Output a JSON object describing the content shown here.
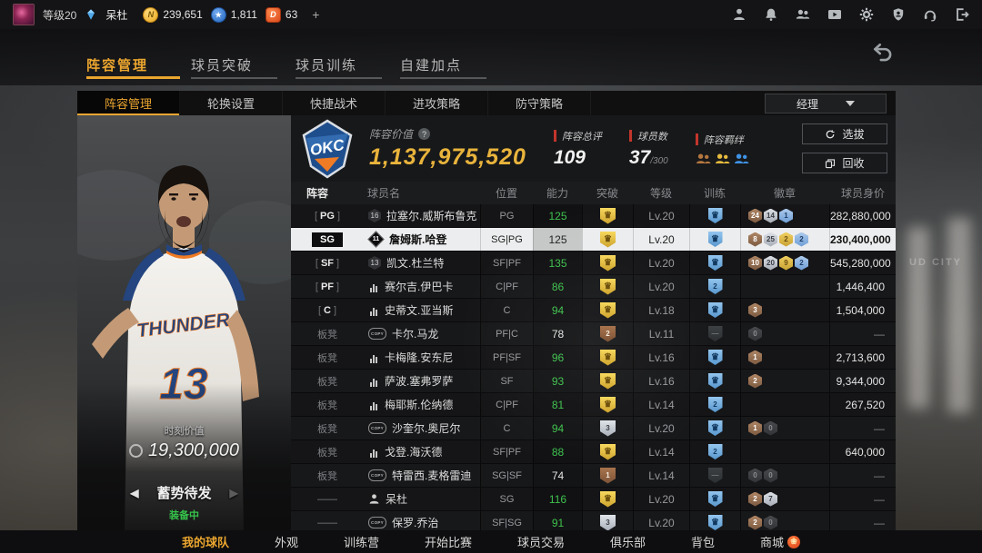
{
  "top_bar": {
    "level": "等级20",
    "username": "呆杜",
    "add_button": "+",
    "currencies": [
      {
        "name": "gold-coin",
        "glyph": "N",
        "label": "239,651"
      },
      {
        "name": "star-points",
        "glyph": "★",
        "label": "1,811"
      },
      {
        "name": "diamond-d",
        "glyph": "D",
        "label": "63"
      }
    ],
    "action_icons": [
      "profile-icon",
      "bell-icon",
      "friends-icon",
      "video-icon",
      "gear-icon",
      "security-icon",
      "headset-icon",
      "exit-icon"
    ]
  },
  "main_tabs": [
    {
      "label": "阵容管理",
      "active": true
    },
    {
      "label": "球员突破",
      "active": false
    },
    {
      "label": "球员训练",
      "active": false
    },
    {
      "label": "自建加点",
      "active": false
    }
  ],
  "sub_tabs": [
    {
      "label": "阵容管理",
      "active": true
    },
    {
      "label": "轮换设置",
      "active": false
    },
    {
      "label": "快捷战术",
      "active": false
    },
    {
      "label": "进攻策略",
      "active": false
    },
    {
      "label": "防守策略",
      "active": false
    }
  ],
  "manager_dropdown": "经理",
  "team": {
    "logo_text": "OKC",
    "value_label": "阵容价值",
    "value_help": "?",
    "value": "1,137,975,520",
    "stats": [
      {
        "label": "阵容总评",
        "value": "109",
        "suffix": ""
      },
      {
        "label": "球员数",
        "value": "37",
        "suffix": "/300"
      }
    ],
    "synergy_label": "阵容羁绊",
    "synergy_tiers": [
      "bronze",
      "gold",
      "blue"
    ],
    "select_button": "选拔",
    "recycle_button": "回收"
  },
  "player_panel": {
    "value_label": "时刻价值",
    "value": "19,300,000",
    "moment": "蓄势待发",
    "status": "装备中",
    "prev_glyph": "◀",
    "next_glyph": "▶",
    "jersey_text": "THUNDER",
    "jersey_number": "13"
  },
  "table": {
    "headers": [
      "阵容",
      "球员名",
      "位置",
      "能力",
      "突破",
      "等级",
      "训练",
      "徽章",
      "球员身价"
    ],
    "rows": [
      {
        "slot": "PG",
        "slot_type": "starter",
        "icon": "num",
        "icon_text": "16",
        "name": "拉塞尔.威斯布鲁克",
        "pos": "PG",
        "ability": "125",
        "ability_state": "green",
        "break_tier": "gold",
        "break_glyph": "crown",
        "level": "Lv.20",
        "train_tier": "blue",
        "train_glyph": "crown",
        "badges": [
          [
            "bronze",
            "24"
          ],
          [
            "silver",
            "14"
          ],
          [
            "blue",
            "1"
          ]
        ],
        "price": "282,880,000",
        "selected": false
      },
      {
        "slot": "SG",
        "slot_type": "starter",
        "icon": "diamond",
        "icon_text": "11",
        "name": "詹姆斯.哈登",
        "pos": "SG|PG",
        "ability": "125",
        "ability_state": "plain",
        "break_tier": "gold",
        "break_glyph": "crown",
        "level": "Lv.20",
        "train_tier": "blue",
        "train_glyph": "crown",
        "badges": [
          [
            "bronze",
            "8"
          ],
          [
            "silver",
            "25"
          ],
          [
            "gold",
            "2"
          ],
          [
            "blue",
            "2"
          ]
        ],
        "price": "230,400,000",
        "selected": true
      },
      {
        "slot": "SF",
        "slot_type": "starter",
        "icon": "num",
        "icon_text": "13",
        "name": "凯文.杜兰特",
        "pos": "SF|PF",
        "ability": "135",
        "ability_state": "green",
        "break_tier": "gold",
        "break_glyph": "crown",
        "level": "Lv.20",
        "train_tier": "blue",
        "train_glyph": "crown",
        "badges": [
          [
            "bronze",
            "10"
          ],
          [
            "silver",
            "20"
          ],
          [
            "gold",
            "9"
          ],
          [
            "blue",
            "2"
          ]
        ],
        "price": "545,280,000",
        "selected": false
      },
      {
        "slot": "PF",
        "slot_type": "starter",
        "icon": "bars",
        "icon_text": "",
        "name": "赛尔吉.伊巴卡",
        "pos": "C|PF",
        "ability": "86",
        "ability_state": "green",
        "break_tier": "gold",
        "break_glyph": "crown",
        "level": "Lv.20",
        "train_tier": "blue",
        "train_glyph": "2",
        "badges": [],
        "price": "1,446,400",
        "selected": false
      },
      {
        "slot": "C",
        "slot_type": "starter",
        "icon": "bars",
        "icon_text": "",
        "name": "史蒂文.亚当斯",
        "pos": "C",
        "ability": "94",
        "ability_state": "green",
        "break_tier": "gold",
        "break_glyph": "crown",
        "level": "Lv.18",
        "train_tier": "blue",
        "train_glyph": "crown",
        "badges": [
          [
            "bronze",
            "3"
          ]
        ],
        "price": "1,504,000",
        "selected": false
      },
      {
        "slot": "板凳",
        "slot_type": "bench",
        "icon": "copy",
        "icon_text": "COPY",
        "name": "卡尔.马龙",
        "pos": "PF|C",
        "ability": "78",
        "ability_state": "plain",
        "break_tier": "bronze",
        "break_glyph": "2",
        "level": "Lv.11",
        "train_tier": "gray",
        "train_glyph": "—",
        "badges": [
          [
            "gray",
            "0"
          ]
        ],
        "price": "—",
        "selected": false
      },
      {
        "slot": "板凳",
        "slot_type": "bench",
        "icon": "bars",
        "icon_text": "",
        "name": "卡梅隆.安东尼",
        "pos": "PF|SF",
        "ability": "96",
        "ability_state": "green",
        "break_tier": "gold",
        "break_glyph": "crown",
        "level": "Lv.16",
        "train_tier": "blue",
        "train_glyph": "crown",
        "badges": [
          [
            "bronze",
            "1"
          ]
        ],
        "price": "2,713,600",
        "selected": false
      },
      {
        "slot": "板凳",
        "slot_type": "bench",
        "icon": "bars",
        "icon_text": "",
        "name": "萨波.塞弗罗萨",
        "pos": "SF",
        "ability": "93",
        "ability_state": "green",
        "break_tier": "gold",
        "break_glyph": "crown",
        "level": "Lv.16",
        "train_tier": "blue",
        "train_glyph": "crown",
        "badges": [
          [
            "bronze",
            "2"
          ]
        ],
        "price": "9,344,000",
        "selected": false
      },
      {
        "slot": "板凳",
        "slot_type": "bench",
        "icon": "bars",
        "icon_text": "",
        "name": "梅耶斯.伦纳德",
        "pos": "C|PF",
        "ability": "81",
        "ability_state": "green",
        "break_tier": "gold",
        "break_glyph": "crown",
        "level": "Lv.14",
        "train_tier": "blue",
        "train_glyph": "2",
        "badges": [],
        "price": "267,520",
        "selected": false
      },
      {
        "slot": "板凳",
        "slot_type": "bench",
        "icon": "copy",
        "icon_text": "COPY",
        "name": "沙奎尔.奥尼尔",
        "pos": "C",
        "ability": "94",
        "ability_state": "green",
        "break_tier": "silver",
        "break_glyph": "3",
        "level": "Lv.20",
        "train_tier": "blue",
        "train_glyph": "crown",
        "badges": [
          [
            "bronze",
            "1"
          ],
          [
            "gray",
            "0"
          ]
        ],
        "price": "—",
        "selected": false
      },
      {
        "slot": "板凳",
        "slot_type": "bench",
        "icon": "bars",
        "icon_text": "",
        "name": "戈登.海沃德",
        "pos": "SF|PF",
        "ability": "88",
        "ability_state": "green",
        "break_tier": "gold",
        "break_glyph": "crown",
        "level": "Lv.14",
        "train_tier": "blue",
        "train_glyph": "2",
        "badges": [],
        "price": "640,000",
        "selected": false
      },
      {
        "slot": "板凳",
        "slot_type": "bench",
        "icon": "copy",
        "icon_text": "COPY",
        "name": "特雷西.麦格雷迪",
        "pos": "SG|SF",
        "ability": "74",
        "ability_state": "plain",
        "break_tier": "bronze",
        "break_glyph": "1",
        "level": "Lv.14",
        "train_tier": "gray",
        "train_glyph": "—",
        "badges": [
          [
            "gray",
            "0"
          ],
          [
            "gray",
            "0"
          ]
        ],
        "price": "—",
        "selected": false
      },
      {
        "slot": "——",
        "slot_type": "none",
        "icon": "person",
        "icon_text": "",
        "name": "呆杜",
        "pos": "SG",
        "ability": "116",
        "ability_state": "green",
        "break_tier": "gold",
        "break_glyph": "crown",
        "level": "Lv.20",
        "train_tier": "blue",
        "train_glyph": "crown",
        "badges": [
          [
            "bronze",
            "2"
          ],
          [
            "silver",
            "7"
          ]
        ],
        "price": "—",
        "selected": false
      },
      {
        "slot": "——",
        "slot_type": "none",
        "icon": "copy",
        "icon_text": "COPY",
        "name": "保罗.乔治",
        "pos": "SF|SG",
        "ability": "91",
        "ability_state": "green",
        "break_tier": "silver",
        "break_glyph": "3",
        "level": "Lv.20",
        "train_tier": "blue",
        "train_glyph": "crown",
        "badges": [
          [
            "bronze",
            "2"
          ],
          [
            "gray",
            "0"
          ]
        ],
        "price": "—",
        "selected": false
      }
    ]
  },
  "bottom_nav": [
    {
      "label": "我的球队",
      "active": true,
      "badge": false
    },
    {
      "label": "外观",
      "active": false,
      "badge": false
    },
    {
      "label": "训练营",
      "active": false,
      "badge": false
    },
    {
      "label": "开始比赛",
      "active": false,
      "badge": false
    },
    {
      "label": "球员交易",
      "active": false,
      "badge": false
    },
    {
      "label": "俱乐部",
      "active": false,
      "badge": false
    },
    {
      "label": "背包",
      "active": false,
      "badge": false
    },
    {
      "label": "商城",
      "active": false,
      "badge": true
    }
  ]
}
